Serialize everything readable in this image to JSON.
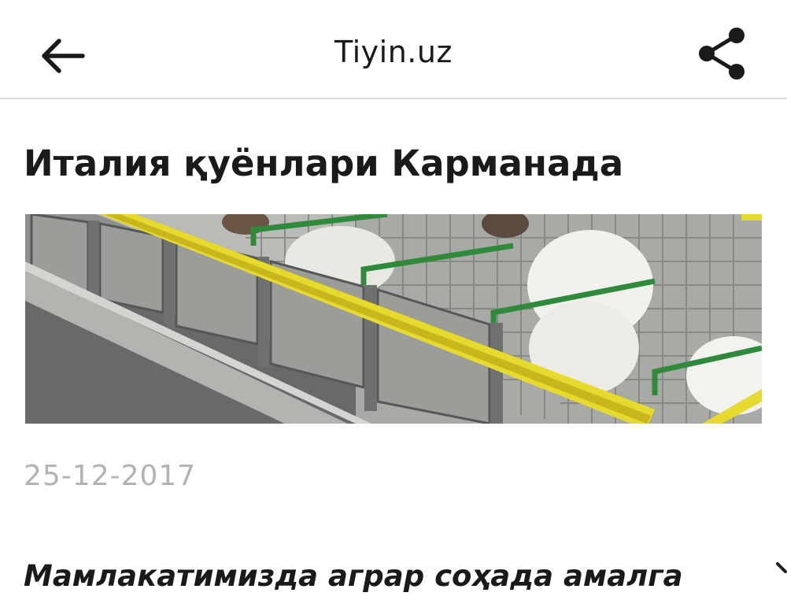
{
  "app_bar": {
    "title": "Tiyin.uz",
    "back_icon": "arrow-left-icon",
    "share_icon": "share-icon"
  },
  "article": {
    "title": "Италия қуёнлари Карманада",
    "image": "rabbits-in-cages-photo",
    "date": "25-12-2017",
    "lead": "Мамлакатимизда аграр соҳада амалга"
  },
  "colors": {
    "text": "#1a1a1a",
    "date": "#b3b3b3",
    "divider": "#d9d9d9",
    "background": "#ffffff"
  }
}
